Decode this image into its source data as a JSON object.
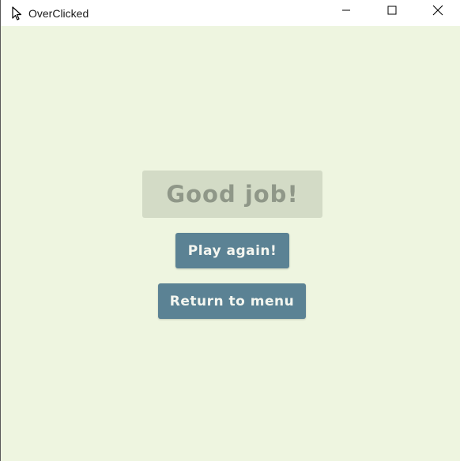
{
  "window": {
    "title": "OverClicked",
    "icon": "cursor-arrow-icon",
    "controls": [
      "minimize-icon",
      "maximize-icon",
      "close-icon"
    ]
  },
  "screen": {
    "headline": "Good job!",
    "play_again_label": "Play again!",
    "return_menu_label": "Return to menu"
  },
  "colors": {
    "background": "#eef5e0",
    "headline_bg": "#d3dbc6",
    "headline_text": "#8f9788",
    "button_bg": "#5b8294",
    "button_text": "#f4f6f0"
  }
}
